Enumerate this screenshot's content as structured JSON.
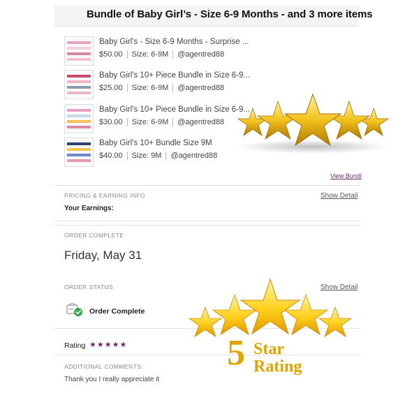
{
  "header": {
    "title": "Bundle of Baby Girl’s - Size 6-9 Months - and 3 more items"
  },
  "items": [
    {
      "title": "Baby Girl's - Size 6-9 Months - Surprise ...",
      "price": "$50.00",
      "size": "Size: 6-9M",
      "seller": "@agentred88"
    },
    {
      "title": "Baby Girl's 10+ Piece Bundle in Size 6-9...",
      "price": "$25.00",
      "size": "Size: 6-9M",
      "seller": "@agentred88"
    },
    {
      "title": "Baby Girl's 10+ Piece Bundle in Size 6-9...",
      "price": "$30.00",
      "size": "Size: 6-9M",
      "seller": "@agentred88"
    },
    {
      "title": "Baby Girl's 10+ Bundle Size 9M",
      "price": "$40.00",
      "size": "Size: 9M",
      "seller": "@agentred88"
    }
  ],
  "view_bundle": "View Bundl",
  "pricing": {
    "label": "PRICING & EARNING INFO",
    "show_detail": "Show Detail",
    "earnings_label": "Your Earnings:"
  },
  "order": {
    "label": "ORDER COMPLETE",
    "date": "Friday, May 31",
    "status_label": "ORDER STATUS",
    "show_detail": "Show Detail",
    "status": "Order Complete"
  },
  "rating": {
    "label": "Rating",
    "stars": "★★★★★",
    "value": 5,
    "comments_label": "ADDITIONAL COMMENTS:",
    "comment": "Thank you I really appreciate it"
  },
  "overlay": {
    "number": "5",
    "line1": "Star",
    "line2": "Rating"
  },
  "colors": {
    "accent": "#6a2b6a",
    "gold": "#e0a400",
    "status_green": "#2fa84f"
  }
}
